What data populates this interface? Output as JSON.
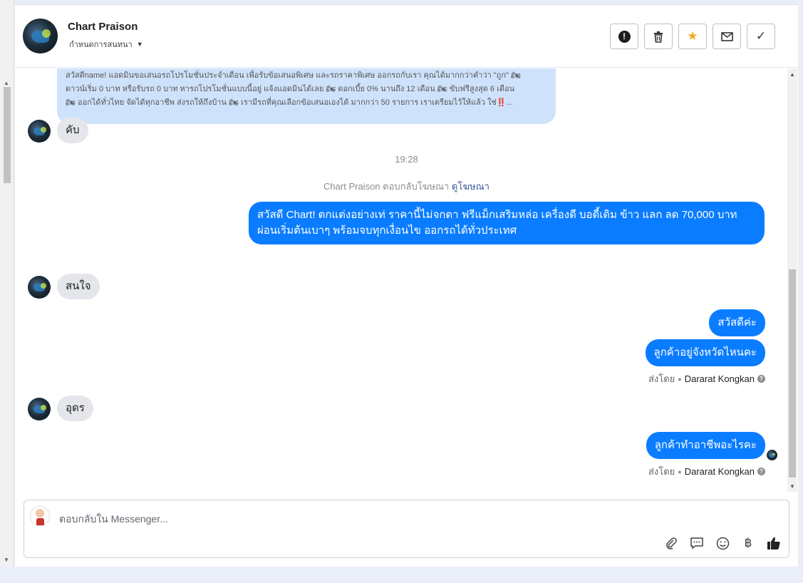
{
  "header": {
    "name": "Chart Praison",
    "subtitle": "กำหนดการสนทนา",
    "buttons": {
      "alert": "!",
      "delete": "🗑",
      "star": "★",
      "mail": "✉",
      "done": "✓"
    }
  },
  "thread": {
    "ad_message": {
      "line1": "สวัสดีname! แอดมินขอเสนอรถโปรโมชั่นประจำเดือน เพื่อรับข้อเสนอพิเศษ และรถราคาพิเศษ ออกรถกับเรา คุณได้มากกว่าคำว่า \"ถูก\" 🏍",
      "line2": "ดาวน์เริ่ม 0 บาท หรือรับรถ 0 บาท หารถโปรโมชั่นแบบนี้อยู่ แจ้งแอดมินได้เลย 🏍 ดอกเบี้ย 0% นานถึง 12 เดือน 🏍 ขับฟรีสูงสุด 6 เดือน",
      "line3": "🏍 ออกได้ทั่วไทย จัดได้ทุกอาชีพ ส่งรถให้ถึงบ้าน 🏍 เรามีรถที่คุณเลือกข้อเสนอเองได้ มากกว่า 50 รายการ เราเตรียมไว้ให้แล้ว ใช่‼️..."
    },
    "msg_kap": "คับ",
    "time": "19:28",
    "reply_note": "Chart Praison ตอบกลับโฆษณา",
    "reply_link": "ดูโฆษณา",
    "out_ad": {
      "line1": "สวัสดี Chart! ตกแต่งอย่างเท่ ราคานี้ไม่จกตา ฟรีแม็กเสริมหล่อ เครื่องดี บอดี้เดิม ข้าว แลก ลด 70,000 บาท",
      "line2": "ผ่อนเริ่มต้นเบาๆ พร้อมจบทุกเงื่อนไข ออกรถได้ทั่วประเทศ"
    },
    "msg_interested": "สนใจ",
    "out_hello": "สวัสดีค่ะ",
    "out_province": "ลูกค้าอยู่จังหวัดไหนคะ",
    "sent_by_label": "ส่งโดย",
    "sent_by_name": "Dararat Kongkan",
    "msg_udon": "อุดร",
    "out_job": "ลูกค้าทำอาชีพอะไรคะ"
  },
  "composer": {
    "placeholder": "ตอบกลับใน Messenger...",
    "currency_symbol": "฿"
  }
}
